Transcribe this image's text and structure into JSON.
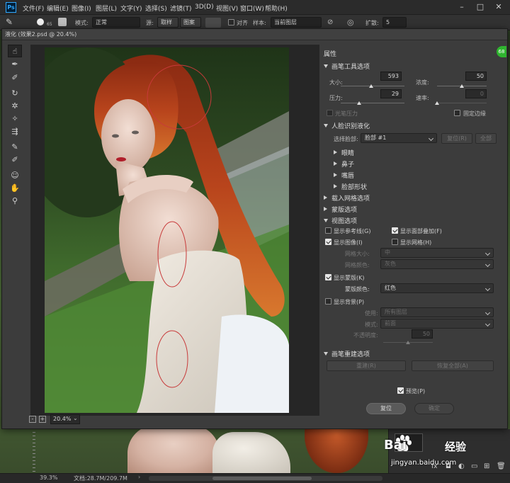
{
  "app": {
    "logo_text": "Ps",
    "menu": [
      "文件(F)",
      "编辑(E)",
      "图像(I)",
      "图层(L)",
      "文字(Y)",
      "选择(S)",
      "滤镜(T)",
      "3D(D)",
      "视图(V)",
      "窗口(W)",
      "帮助(H)"
    ],
    "options_bar": {
      "brush_size": "65",
      "mode_label": "模式:",
      "mode_value": "正常",
      "source_label": "源:",
      "source_sample": "取样",
      "source_pattern": "图案",
      "align_label": "对齐",
      "sample_label": "样本:",
      "sample_value": "当前图层",
      "spread_label": "扩散:",
      "spread_value": "5"
    }
  },
  "dialog": {
    "title": "液化 (效果2.psd @ 20.4%)",
    "zoom_value": "20.4%",
    "zoom_minus": "-",
    "zoom_plus": "+",
    "panel_title": "属性",
    "brush_section": {
      "title": "画笔工具选项",
      "size_label": "大小:",
      "size_value": "593",
      "size_fraction": 0.48,
      "density_label": "浓度:",
      "density_value": "50",
      "density_fraction": 0.5,
      "pressure_label": "压力:",
      "pressure_value": "29",
      "pressure_fraction": 0.29,
      "rate_label": "速率:",
      "rate_value": "0",
      "rate_fraction": 0.0,
      "stylus_label": "光笔压力",
      "pin_edges_label": "固定边缘"
    },
    "face_section": {
      "title": "人脸识别液化",
      "select_face_label": "选择脸部:",
      "select_face_value": "脸部 #1",
      "reset_button": "复位(R)",
      "all_button": "全部",
      "subsections": [
        "眼睛",
        "鼻子",
        "嘴唇",
        "脸部形状"
      ]
    },
    "load_mesh_title": "载入网格选项",
    "mask_title": "蒙版选项",
    "view_section": {
      "title": "视图选项",
      "show_guides": "显示参考线(G)",
      "show_face_overlay": "显示面部叠加(F)",
      "show_image": "显示图像(I)",
      "show_mesh": "显示网格(H)",
      "mesh_size_label": "网格大小:",
      "mesh_size_value": "中",
      "mesh_color_label": "网格颜色:",
      "mesh_color_value": "灰色",
      "show_mask": "显示蒙版(K)",
      "mask_color_label": "蒙版颜色:",
      "mask_color_value": "红色",
      "show_backdrop": "显示背景(P)",
      "use_label": "使用:",
      "use_value": "所有图层",
      "mode_label": "模式:",
      "mode_value": "前面",
      "opacity_label": "不透明度:",
      "opacity_value": "50",
      "opacity_fraction": 0.5
    },
    "reconstruct_section": {
      "title": "画笔重建选项",
      "reconstruct_button": "重建(R)",
      "restore_all_button": "恢复全部(A)"
    },
    "preview_label": "预览(P)",
    "ok_button": "复位",
    "cancel_button": "确定"
  },
  "statusbar": {
    "zoom": "39.3%",
    "doc_label": "文档:28.7M/209.7M"
  },
  "watermark": {
    "brand": "Bai",
    "brand_cn": "经验",
    "site": "jingyan.baidu.com"
  },
  "colors": {
    "accent_badge": "#2fb52f",
    "mask_ring": "#c83a3a",
    "hair": "#b8441c"
  }
}
